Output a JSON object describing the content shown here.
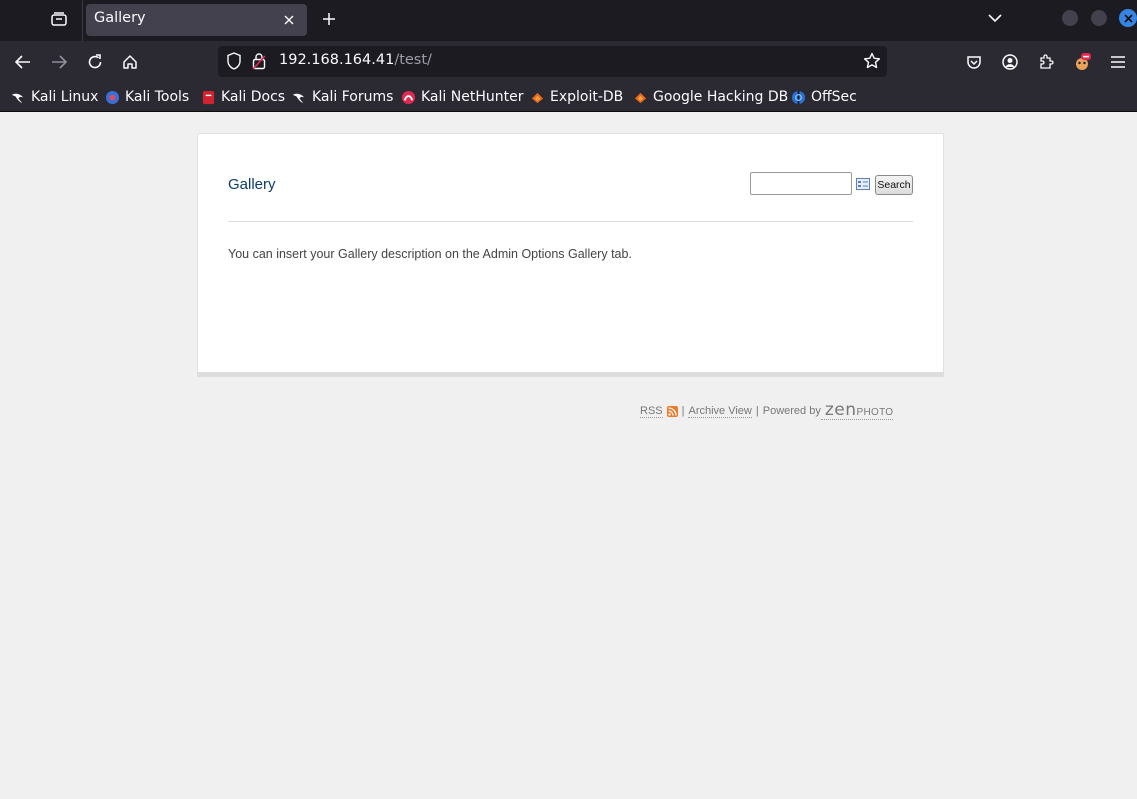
{
  "browser": {
    "tab_title": "Gallery",
    "url_host": "192.168.164.41",
    "url_path": "/test/",
    "bookmarks": [
      {
        "label": "Kali Linux",
        "icon": "kali-dragon-icon"
      },
      {
        "label": "Kali Tools",
        "icon": "kali-tools-icon"
      },
      {
        "label": "Kali Docs",
        "icon": "kali-docs-icon"
      },
      {
        "label": "Kali Forums",
        "icon": "kali-dragon-icon"
      },
      {
        "label": "Kali NetHunter",
        "icon": "nethunter-icon"
      },
      {
        "label": "Exploit-DB",
        "icon": "exploit-db-icon"
      },
      {
        "label": "Google Hacking DB",
        "icon": "exploit-db-icon"
      },
      {
        "label": "OffSec",
        "icon": "offsec-icon"
      }
    ]
  },
  "page": {
    "gallery_title": "Gallery",
    "search_button": "Search",
    "search_value": "",
    "description": "You can insert your Gallery description on the Admin Options Gallery tab."
  },
  "footer": {
    "rss": "RSS",
    "archive_view": "Archive View",
    "powered_by": "Powered by",
    "zen": "zen",
    "photo": "PHOTO",
    "separator": "|"
  },
  "colors": {
    "chrome_dark": "#1c1b22",
    "toolbar": "#2b2a33",
    "page_bg": "#f0f0f0",
    "title_blue": "#0b3d6b",
    "rss_orange": "#ee7a2c"
  }
}
